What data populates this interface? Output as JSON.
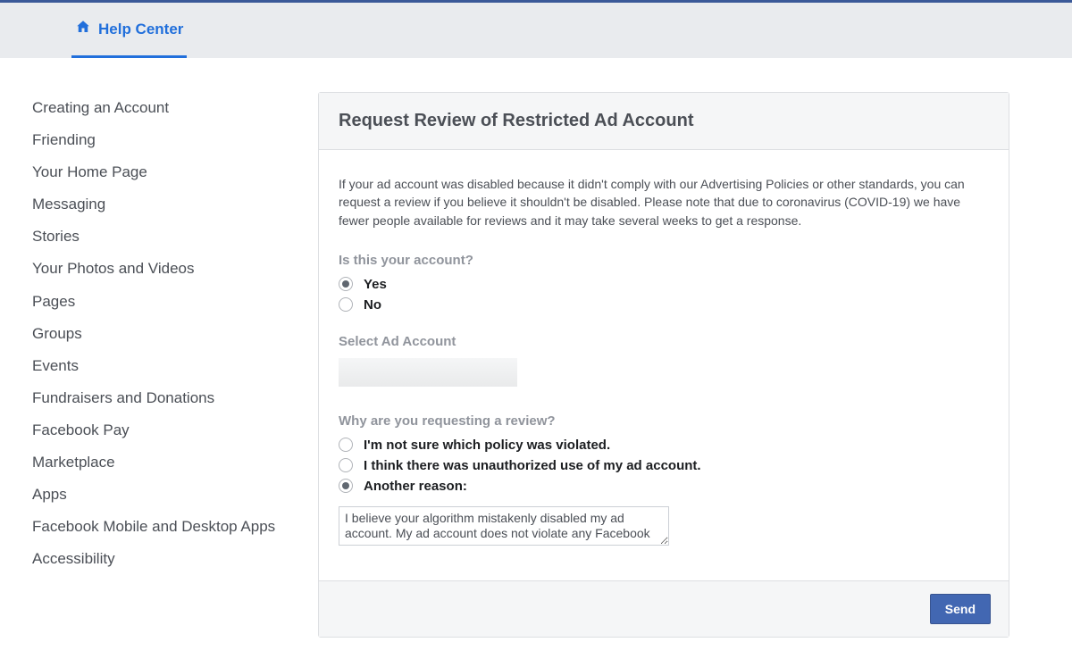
{
  "header": {
    "help_center_label": "Help Center"
  },
  "sidebar": {
    "items": [
      "Creating an Account",
      "Friending",
      "Your Home Page",
      "Messaging",
      "Stories",
      "Your Photos and Videos",
      "Pages",
      "Groups",
      "Events",
      "Fundraisers and Donations",
      "Facebook Pay",
      "Marketplace",
      "Apps",
      "Facebook Mobile and Desktop Apps",
      "Accessibility"
    ]
  },
  "main": {
    "title": "Request Review of Restricted Ad Account",
    "intro": "If your ad account was disabled because it didn't comply with our Advertising Policies or other standards, you can request a review if you believe it shouldn't be disabled. Please note that due to coronavirus (COVID-19) we have fewer people available for reviews and it may take several weeks to get a response.",
    "q1_label": "Is this your account?",
    "q1_options": {
      "yes": "Yes",
      "no": "No"
    },
    "q1_selected": "yes",
    "select_account_label": "Select Ad Account",
    "q2_label": "Why are you requesting a review?",
    "q2_options": {
      "o1": "I'm not sure which policy was violated.",
      "o2": "I think there was unauthorized use of my ad account.",
      "o3": "Another reason:"
    },
    "q2_selected": "o3",
    "reason_text": "I believe your algorithm mistakenly disabled my ad account. My ad account does not violate any Facebook TOS. Please have a human review. Thx",
    "send_label": "Send"
  }
}
